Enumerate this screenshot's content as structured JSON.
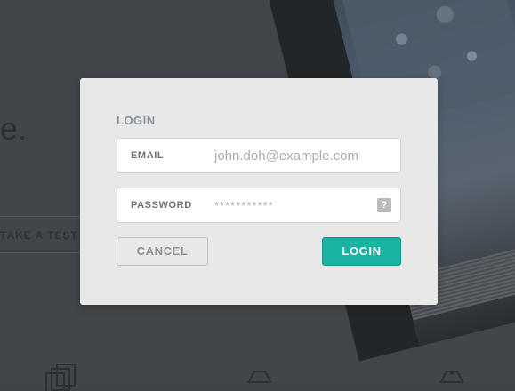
{
  "background": {
    "headline_fragment": "e.",
    "take_test_label": "TAKE A TEST"
  },
  "login_modal": {
    "title": "LOGIN",
    "email": {
      "label": "EMAIL",
      "placeholder": "john.doh@example.com",
      "value": ""
    },
    "password": {
      "label": "PASSWORD",
      "placeholder": "***********",
      "value": "",
      "help_glyph": "?"
    },
    "cancel_label": "CANCEL",
    "login_label": "LOGIN"
  },
  "colors": {
    "accent": "#17b3a3",
    "modal_background": "#e8e8e8",
    "overlay": "#41464a"
  },
  "icons": [
    "help-icon",
    "documents-icon",
    "hexagon-icon"
  ]
}
